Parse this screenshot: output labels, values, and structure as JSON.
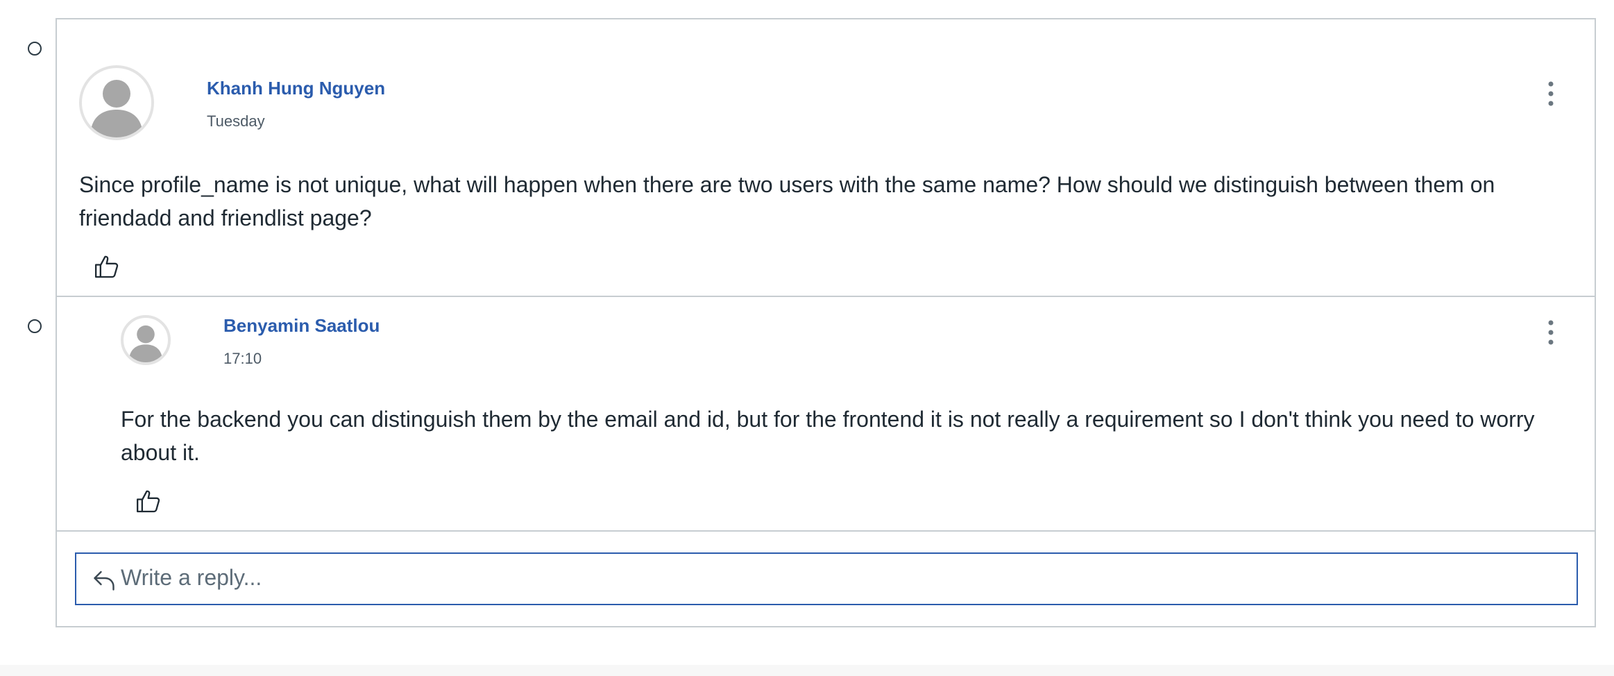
{
  "discussion": {
    "entries": [
      {
        "author": "Khanh Hung Nguyen",
        "timestamp": "Tuesday",
        "message": "Since profile_name is not unique, what will happen when there are two users with the same name? How should we distinguish between them on friendadd and friendlist page?",
        "avatar_icon": "default-user-avatar-icon",
        "options_icon": "kebab-menu-icon",
        "like_icon": "thumbs-up-icon"
      },
      {
        "author": "Benyamin Saatlou",
        "timestamp": "17:10",
        "message": "For the backend you can distinguish them by the email and id, but for the frontend it is not really a requirement so I don't think you need to worry about it.",
        "avatar_icon": "default-user-avatar-icon",
        "options_icon": "kebab-menu-icon",
        "like_icon": "thumbs-up-icon"
      }
    ],
    "reply": {
      "placeholder": "Write a reply...",
      "icon": "reply-arrow-icon"
    }
  },
  "colors": {
    "author_link": "#2b5cad",
    "border": "#c7cdd1",
    "reply_focus_border": "#2b5cad",
    "text": "#1f2a33"
  }
}
